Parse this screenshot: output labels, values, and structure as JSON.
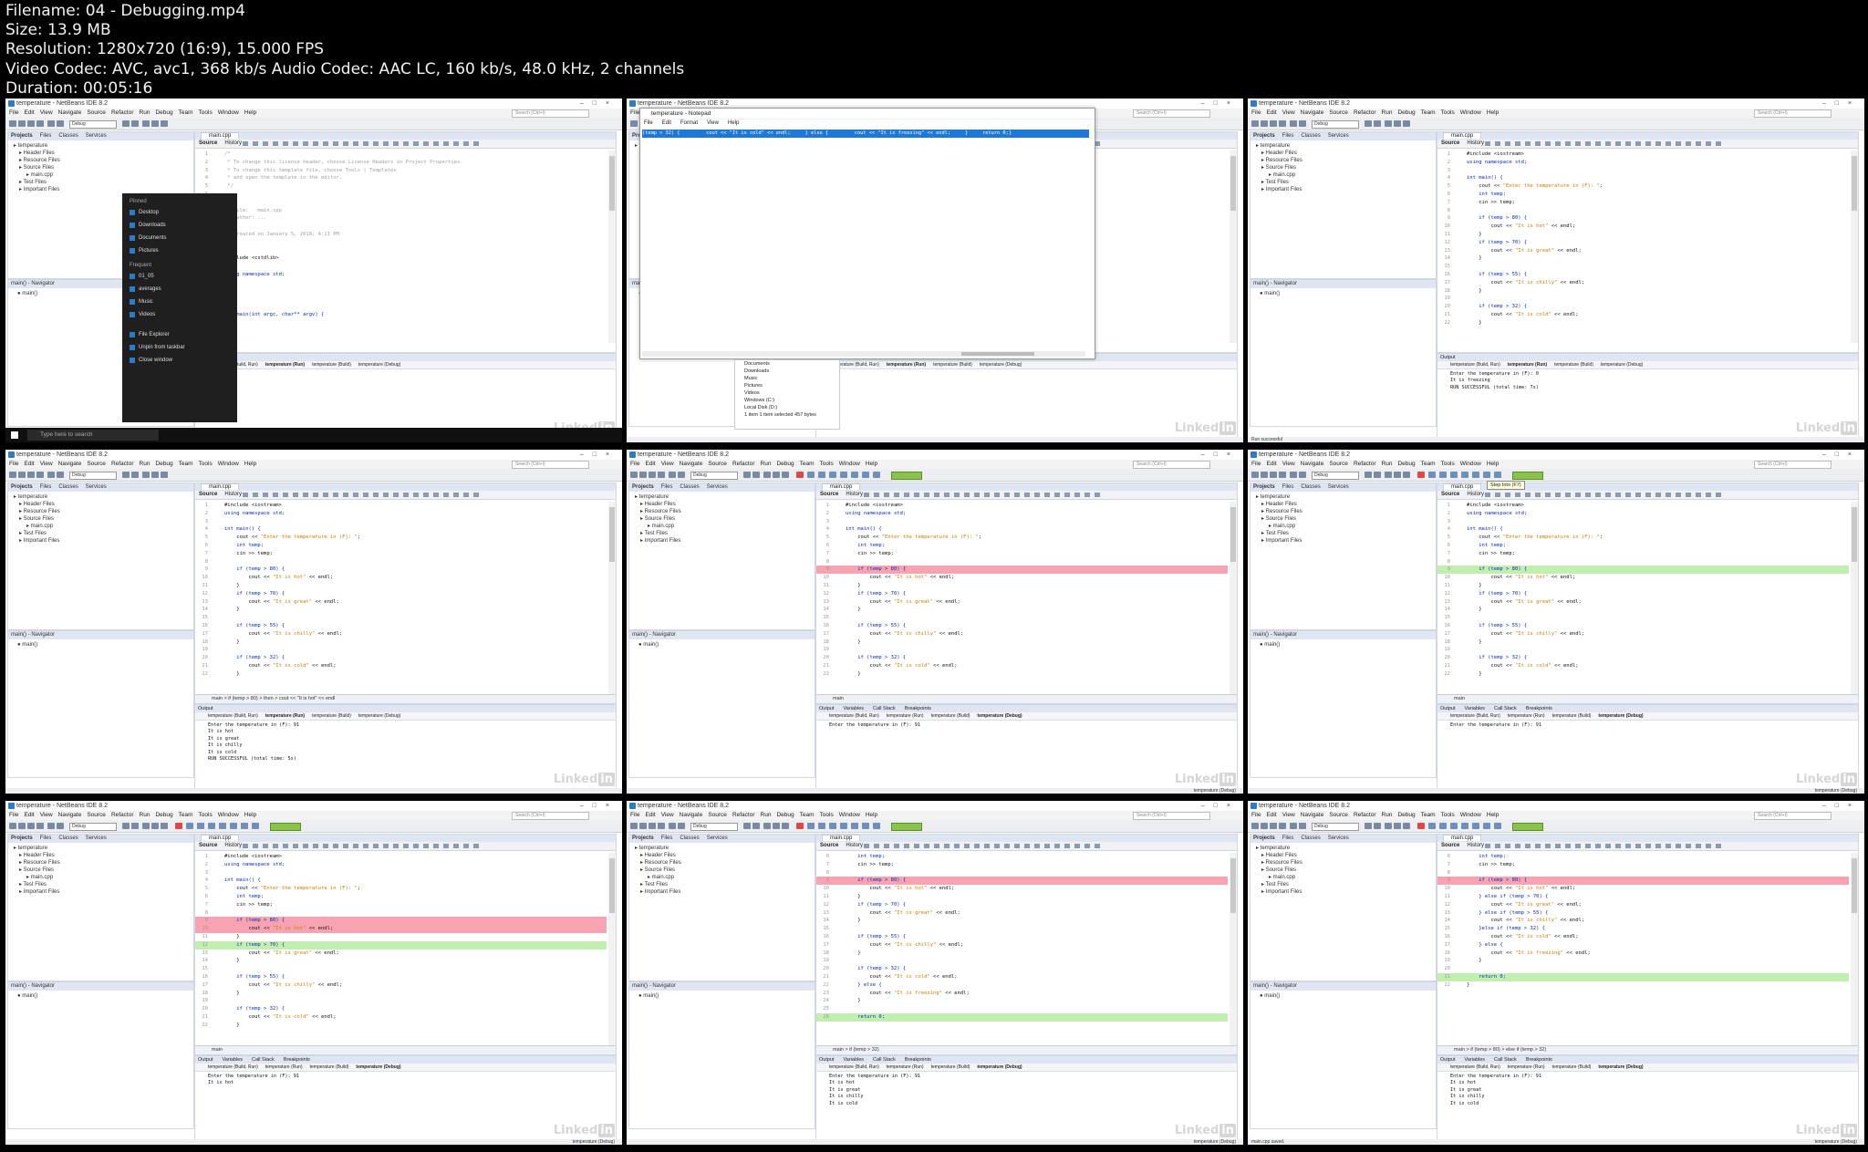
{
  "header": {
    "filename": "Filename: 04 - Debugging.mp4",
    "size": "Size: 13.9 MB",
    "resolution": "Resolution: 1280x720 (16:9), 15.000 FPS",
    "codec": "Video Codec: AVC, avc1, 368 kb/s Audio Codec: AAC LC, 160 kb/s, 48.0 kHz, 2 channels",
    "duration": "Duration: 00:05:16"
  },
  "ide": {
    "title": "temperature - NetBeans IDE 8.2",
    "menu": [
      "File",
      "Edit",
      "View",
      "Navigate",
      "Source",
      "Refactor",
      "Run",
      "Debug",
      "Team",
      "Tools",
      "Window",
      "Help"
    ],
    "search_placeholder": "Search (Ctrl+I)",
    "config": "Debug",
    "project_tabs": [
      "Projects",
      "Files",
      "Classes",
      "Services"
    ],
    "project_tree": [
      "temperature",
      "Header Files",
      "Resource Files",
      "Source Files",
      "main.cpp",
      "Test Files",
      "Important Files"
    ],
    "navigator_title": "main() - Navigator",
    "navigator_item": "main()",
    "editor_tab": "main.cpp",
    "source_tabs": [
      "Source",
      "History"
    ],
    "output_tabs": [
      "Output",
      "Variables",
      "Call Stack",
      "Breakpoints"
    ],
    "output_subtabs": [
      "temperature (Build, Run)",
      "temperature (Run)",
      "temperature (Build)",
      "temperature (Debug)"
    ],
    "status_debug": "temperature (Debug)",
    "watermark": "Linked",
    "watermark_in": "in"
  },
  "code_v1": [
    "#include <iostream>",
    "using namespace std;",
    "",
    "int main() {",
    "    cout << \"Enter the temperature in (F): \";",
    "    int temp;",
    "    cin >> temp;",
    "",
    "    if (temp > 80) {",
    "        cout << \"It is hot\" << endl;",
    "    }",
    "    if (temp > 70) {",
    "        cout << \"It is great\" << endl;",
    "    }",
    "",
    "    if (temp > 55) {",
    "        cout << \"It is chilly\" << endl;",
    "    }",
    "",
    "    if (temp > 32) {",
    "        cout << \"It is cold\" << endl;",
    "    }"
  ],
  "code_v2": [
    "    int temp;",
    "    cin >> temp;",
    "",
    "    if (temp > 80) {",
    "        cout << \"It is hot\" << endl;",
    "    }",
    "    if (temp > 70) {",
    "        cout << \"It is great\" << endl;",
    "    }",
    "",
    "    if (temp > 55) {",
    "        cout << \"It is chilly\" << endl;",
    "    }",
    "",
    "    if (temp > 32) {",
    "        cout << \"It is cold\" << endl;",
    "    } else {",
    "        cout << \"It is freezing\" << endl;",
    "    }",
    "",
    "    return 0;"
  ],
  "code_v3": [
    "    int temp;",
    "    cin >> temp;",
    "",
    "    if (temp > 80) {",
    "        cout << \"It is hot\" << endl;",
    "    } else if (temp > 70) {",
    "        cout << \"It is great\" << endl;",
    "    } else if (temp > 55) {",
    "        cout << \"It is chilly\" << endl;",
    "    }else if (temp > 32) {",
    "        cout << \"It is cold\" << endl;",
    "    } else {",
    "        cout << \"It is freezing\" << endl;",
    "    }",
    "",
    "    return 0;",
    "}"
  ],
  "code_comment": [
    "/*",
    " * To change this license header, choose License Headers in Project Properties.",
    " * To change this template file, choose Tools | Templates",
    " * and open the template in the editor.",
    " */",
    "",
    "/*",
    " * File:   main.cpp",
    " * Author: ...",
    " *",
    " * Created on January 5, 2018, 4:11 PM",
    " */",
    "",
    "#include <cstdlib>",
    "",
    "using namespace std;",
    "",
    "/*",
    " *",
    " */",
    "int main(int argc, char** argv) {"
  ],
  "outputs": {
    "prompt": "Enter the temperature in (F): ",
    "run1": [
      "Enter the temperature in (F): 0",
      "It is freezing",
      "",
      "RUN SUCCESSFUL (total time: 7s)"
    ],
    "run2": [
      "Enter the temperature in (F): 91",
      "It is hot",
      "It is great",
      "It is chilly",
      "It is cold",
      "",
      "RUN SUCCESSFUL (total time: 5s)"
    ],
    "dbg_a": [
      "Enter the temperature in (F): 91"
    ],
    "dbg_b": [
      "Enter the temperature in (F): 91",
      "It is hot"
    ],
    "dbg_c": [
      "Enter the temperature in (F): 91",
      "It is hot",
      "It is great",
      "It is chilly",
      "It is cold"
    ]
  },
  "breadcrumbs": {
    "b1": "main  >  if (temp > 80)  >  then  >  cout << \"It is hot\" << endl",
    "b2": "main",
    "b3": "main  >  if (temp > 32)",
    "b4": "main  >  if (temp > 80)  >  else if (temp > 32)"
  },
  "startmenu": {
    "pinned_label": "Pinned",
    "pinned": [
      "Desktop",
      "Downloads",
      "Documents",
      "Pictures"
    ],
    "frequent_label": "Frequent",
    "frequent": [
      "01_05",
      "averages",
      "Music",
      "Videos"
    ],
    "actions": [
      "File Explorer",
      "Unpin from taskbar",
      "Close window"
    ],
    "search": "Type here to search"
  },
  "notepad": {
    "title": "temperature - Notepad",
    "menu": [
      "File",
      "Edit",
      "Format",
      "View",
      "Help"
    ],
    "selected_text": "(temp > 32) {         cout << \"It is cold\" << endl;     } else {         cout << \"It is freezing\" << endl;     }     return 0;}"
  },
  "explorer": {
    "items": [
      "Documents",
      "Downloads",
      "Music",
      "Pictures",
      "Videos",
      "Windows (C:)",
      "Local Disk (D:)"
    ],
    "status": "1 item    1 item selected  457 bytes"
  },
  "tooltip": "Step Into (F7)",
  "status": {
    "run_ok": "Run successful",
    "saved": "main.cpp saved."
  }
}
